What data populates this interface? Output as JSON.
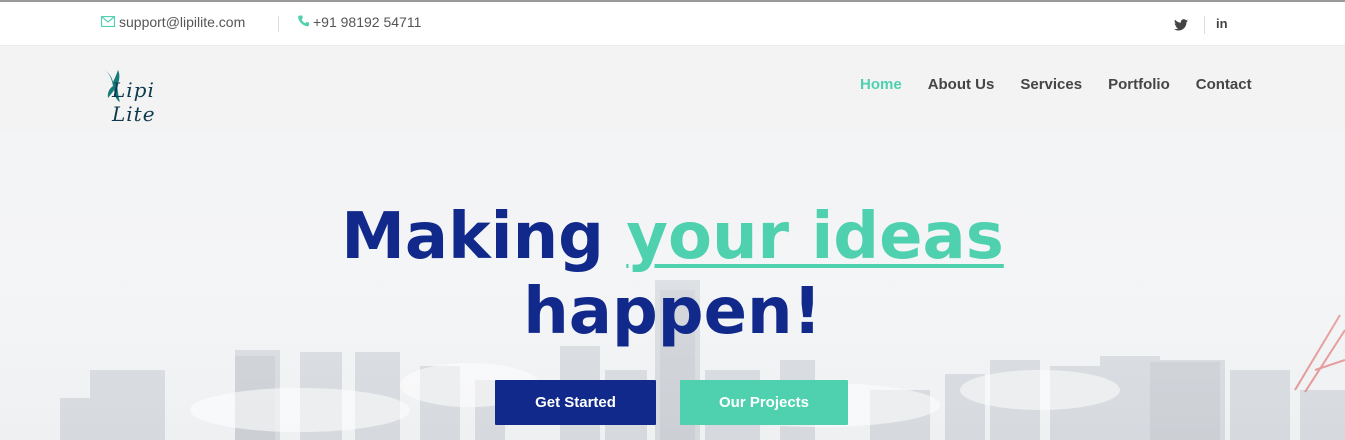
{
  "topbar": {
    "email": "support@lipilite.com",
    "phone": "+91 98192 54711",
    "email_icon": "envelope-icon",
    "phone_icon": "phone-icon",
    "social": [
      "twitter-icon",
      "linkedin-icon"
    ],
    "linkedin_label": "in"
  },
  "brand": {
    "logo_text": "Lipi Lite"
  },
  "nav": {
    "items": [
      {
        "label": "Home",
        "active": true
      },
      {
        "label": "About Us",
        "active": false
      },
      {
        "label": "Services",
        "active": false
      },
      {
        "label": "Portfolio",
        "active": false
      },
      {
        "label": "Contact",
        "active": false
      }
    ]
  },
  "hero": {
    "line1_prefix": "Making",
    "line1_accent": "your ideas",
    "line2": "happen!",
    "primary_button": "Get Started",
    "secondary_button": "Our Projects"
  },
  "colors": {
    "accent": "#4fd1b0",
    "primary": "#11298a",
    "nav_text": "#454545"
  }
}
